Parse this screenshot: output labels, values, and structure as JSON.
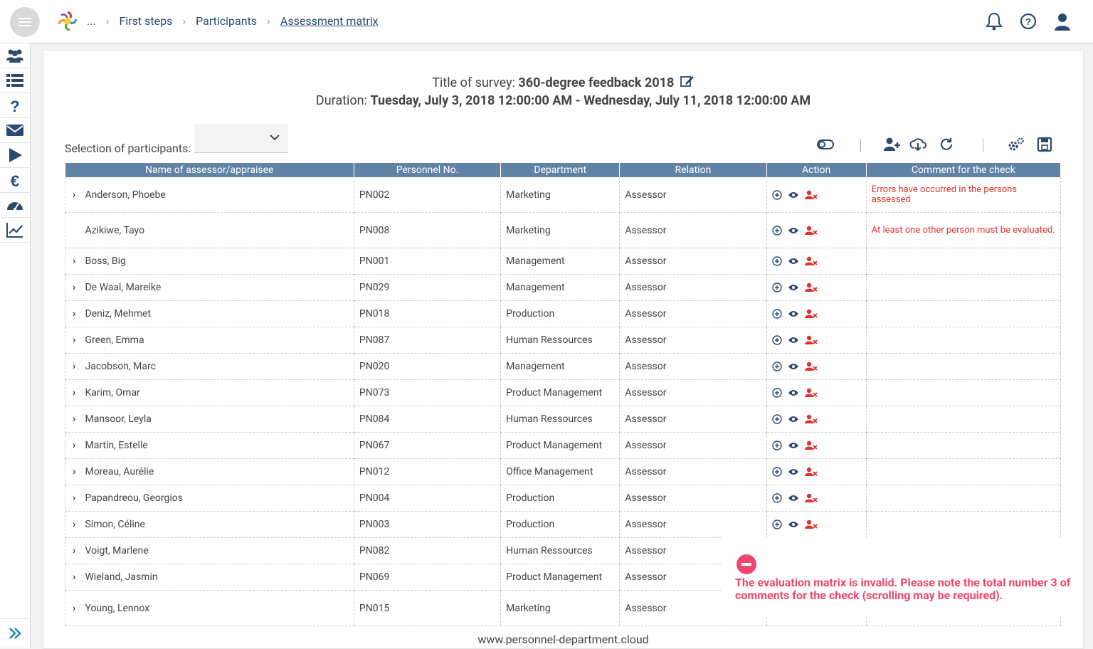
{
  "breadcrumb": {
    "ellipsis": "...",
    "items": [
      "First steps",
      "Participants",
      "Assessment matrix"
    ]
  },
  "survey": {
    "title_label": "Title of survey:",
    "title_value": "360-degree feedback 2018",
    "duration_label": "Duration:",
    "duration_value": "Tuesday, July 3, 2018 12:00:00 AM - Wednesday, July 11, 2018 12:00:00 AM"
  },
  "selection": {
    "label": "Selection of participants:",
    "value": ""
  },
  "table": {
    "headers": [
      "Name of assessor/appraisee",
      "Personnel No.",
      "Department",
      "Relation",
      "Action",
      "Comment for the check"
    ],
    "rows": [
      {
        "name": "Anderson, Phoebe",
        "pn": "PN002",
        "dept": "Marketing",
        "rel": "Assessor",
        "comment": "Errors have occurred in the persons assessed",
        "expand": true
      },
      {
        "name": "Azikiwe, Tayo",
        "pn": "PN008",
        "dept": "Marketing",
        "rel": "Assessor",
        "comment": "At least one other person must be evaluated.",
        "expand": false
      },
      {
        "name": "Boss, Big",
        "pn": "PN001",
        "dept": "Management",
        "rel": "Assessor",
        "comment": "",
        "expand": true
      },
      {
        "name": "De Waal, Mareike",
        "pn": "PN029",
        "dept": "Management",
        "rel": "Assessor",
        "comment": "",
        "expand": true
      },
      {
        "name": "Deniz, Mehmet",
        "pn": "PN018",
        "dept": "Production",
        "rel": "Assessor",
        "comment": "",
        "expand": true
      },
      {
        "name": "Green, Emma",
        "pn": "PN087",
        "dept": "Human Ressources",
        "rel": "Assessor",
        "comment": "",
        "expand": true
      },
      {
        "name": "Jacobson, Marc",
        "pn": "PN020",
        "dept": "Management",
        "rel": "Assessor",
        "comment": "",
        "expand": true
      },
      {
        "name": "Karim, Omar",
        "pn": "PN073",
        "dept": "Product Management",
        "rel": "Assessor",
        "comment": "",
        "expand": true
      },
      {
        "name": "Mansoor, Leyla",
        "pn": "PN084",
        "dept": "Human Ressources",
        "rel": "Assessor",
        "comment": "",
        "expand": true
      },
      {
        "name": "Martin, Estelle",
        "pn": "PN067",
        "dept": "Product Management",
        "rel": "Assessor",
        "comment": "",
        "expand": true
      },
      {
        "name": "Moreau, Aurélie",
        "pn": "PN012",
        "dept": "Office Management",
        "rel": "Assessor",
        "comment": "",
        "expand": true
      },
      {
        "name": "Papandreou, Georgios",
        "pn": "PN004",
        "dept": "Production",
        "rel": "Assessor",
        "comment": "",
        "expand": true
      },
      {
        "name": "Simon, Céline",
        "pn": "PN003",
        "dept": "Production",
        "rel": "Assessor",
        "comment": "",
        "expand": true
      },
      {
        "name": "Voigt, Marlene",
        "pn": "PN082",
        "dept": "Human Ressources",
        "rel": "Assessor",
        "comment": "",
        "expand": true
      },
      {
        "name": "Wieland, Jasmin",
        "pn": "PN069",
        "dept": "Product Management",
        "rel": "Assessor",
        "comment": "",
        "expand": true
      },
      {
        "name": "Young, Lennox",
        "pn": "PN015",
        "dept": "Marketing",
        "rel": "Assessor",
        "comment": "",
        "expand": true
      }
    ]
  },
  "footer": "www.personnel-department.cloud",
  "toast": {
    "message": "The evaluation matrix is invalid. Please note the total number 3 of comments for the check (scrolling may be required)."
  },
  "colors": {
    "accent": "#2b4a6f",
    "header_bg": "#6283a6",
    "error": "#e0322f",
    "toast": "#ef476f"
  }
}
